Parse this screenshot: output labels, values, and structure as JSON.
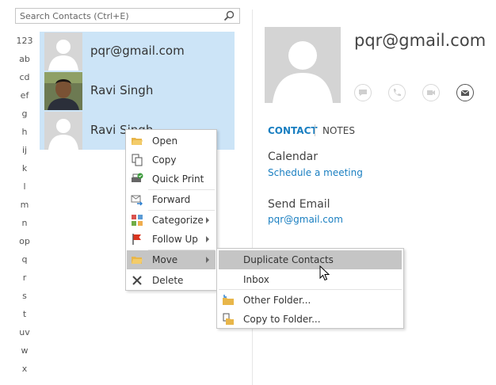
{
  "search": {
    "placeholder": "Search Contacts (Ctrl+E)"
  },
  "index": [
    "123",
    "ab",
    "cd",
    "ef",
    "g",
    "h",
    "ij",
    "k",
    "l",
    "m",
    "n",
    "op",
    "q",
    "r",
    "s",
    "t",
    "uv",
    "w",
    "x"
  ],
  "contacts": [
    {
      "name": "pqr@gmail.com"
    },
    {
      "name": "Ravi Singh"
    },
    {
      "name": "Ravi Singh"
    }
  ],
  "detail": {
    "name": "pqr@gmail.com",
    "tabs": {
      "contact": "CONTACT",
      "notes": "NOTES"
    },
    "calendar": {
      "heading": "Calendar",
      "link": "Schedule a meeting"
    },
    "email": {
      "heading": "Send Email",
      "address": "pqr@gmail.com"
    },
    "actions": [
      "chat-icon",
      "phone-icon",
      "video-icon",
      "email-icon"
    ]
  },
  "context_menu": {
    "items": [
      {
        "label": "Open",
        "icon": "folder-open-icon"
      },
      {
        "label": "Copy",
        "icon": "copy-icon"
      },
      {
        "label": "Quick Print",
        "icon": "printer-icon"
      },
      {
        "label": "Forward",
        "icon": "forward-icon"
      },
      {
        "label": "Categorize",
        "icon": "categorize-icon",
        "has_submenu": true
      },
      {
        "label": "Follow Up",
        "icon": "flag-icon",
        "has_submenu": true
      },
      {
        "label": "Move",
        "icon": "folder-move-icon",
        "has_submenu": true,
        "selected": true
      },
      {
        "label": "Delete",
        "icon": "delete-icon"
      }
    ]
  },
  "move_submenu": {
    "items": [
      {
        "label": "Duplicate Contacts",
        "selected": true
      },
      {
        "label": "Inbox"
      },
      {
        "label": "Other Folder...",
        "icon": "other-folder-icon"
      },
      {
        "label": "Copy to Folder...",
        "icon": "copy-to-folder-icon"
      }
    ]
  },
  "colors": {
    "selection": "#cce4f7",
    "link": "#1a7fc1",
    "menu_highlight": "#c5c5c5"
  }
}
